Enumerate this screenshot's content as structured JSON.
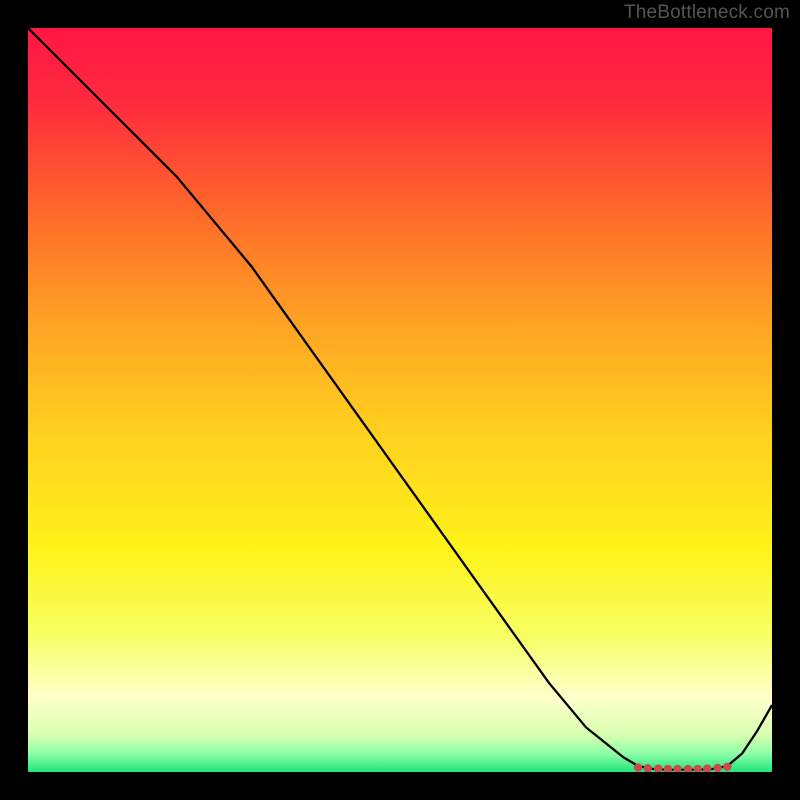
{
  "watermark": "TheBottleneck.com",
  "chart_data": {
    "type": "line",
    "title": "",
    "xlabel": "",
    "ylabel": "",
    "xlim": [
      0,
      100
    ],
    "ylim": [
      0,
      100
    ],
    "grid": false,
    "series": [
      {
        "name": "curve",
        "color": "#000000",
        "x": [
          0,
          5,
          10,
          15,
          20,
          25,
          30,
          35,
          40,
          45,
          50,
          55,
          60,
          65,
          70,
          75,
          80,
          82,
          84,
          86,
          88,
          90,
          92,
          94,
          96,
          98,
          100
        ],
        "y": [
          100,
          95,
          90,
          85,
          80,
          74,
          68,
          61,
          54,
          47,
          40,
          33,
          26,
          19,
          12,
          6,
          2,
          0.8,
          0.4,
          0.3,
          0.3,
          0.3,
          0.4,
          0.8,
          2.5,
          5.5,
          9
        ]
      }
    ],
    "markers": {
      "name": "bottleneck-dots",
      "color": "#cc4a4a",
      "x": [
        82,
        83.3,
        84.7,
        86,
        87.3,
        88.7,
        90,
        91.3,
        92.7,
        94
      ],
      "y": [
        0.6,
        0.5,
        0.45,
        0.4,
        0.4,
        0.4,
        0.4,
        0.45,
        0.55,
        0.7
      ]
    },
    "gradient_stops": [
      {
        "offset": 0,
        "color": "#ff1744"
      },
      {
        "offset": 0.1,
        "color": "#ff2a3e"
      },
      {
        "offset": 0.25,
        "color": "#ff6a2a"
      },
      {
        "offset": 0.4,
        "color": "#ffa424"
      },
      {
        "offset": 0.55,
        "color": "#ffd21f"
      },
      {
        "offset": 0.7,
        "color": "#fff31a"
      },
      {
        "offset": 0.82,
        "color": "#f7ff66"
      },
      {
        "offset": 0.9,
        "color": "#ffffcc"
      },
      {
        "offset": 0.95,
        "color": "#d8ffb0"
      },
      {
        "offset": 0.975,
        "color": "#8effa8"
      },
      {
        "offset": 1.0,
        "color": "#20e47a"
      }
    ]
  }
}
